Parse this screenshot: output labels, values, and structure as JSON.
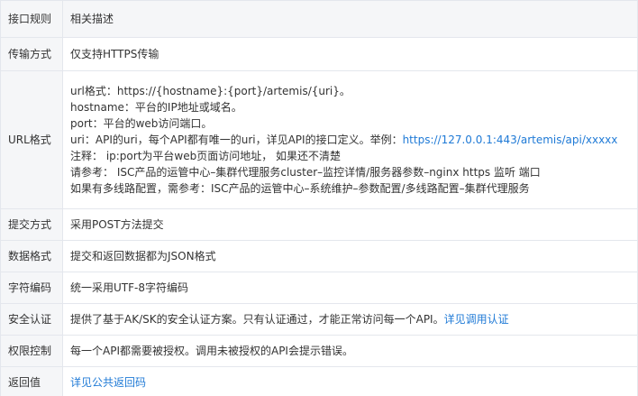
{
  "header": {
    "col1": "接口规则",
    "col2": "相关描述"
  },
  "rows": {
    "transport": {
      "label": "传输方式",
      "desc": "仅支持HTTPS传输"
    },
    "url": {
      "label": "URL格式",
      "line1": "url格式：https://{hostname}:{port}/artemis/{uri}。",
      "line2": "hostname：平台的IP地址或域名。",
      "line3": "port：平台的web访问端口。",
      "line4_text": "uri：API的uri，每个API都有唯一的uri，详见API的接口定义。举例：",
      "line4_link": "https://127.0.0.1:443/artemis/api/xxxxx",
      "line5": "注释：  ip:port为平台web页面访问地址，  如果还不清楚",
      "line6": "请参考：  ISC产品的运管中心–集群代理服务cluster–监控详情/服务器参数–nginx https 监听 端口",
      "line7": "如果有多线路配置，需参考：ISC产品的运管中心–系统维护–参数配置/多线路配置–集群代理服务"
    },
    "submit": {
      "label": "提交方式",
      "desc": "采用POST方法提交"
    },
    "format": {
      "label": "数据格式",
      "desc": "提交和返回数据都为JSON格式"
    },
    "encoding": {
      "label": "字符编码",
      "desc": "统一采用UTF-8字符编码"
    },
    "auth": {
      "label": "安全认证",
      "desc": "提供了基于AK/SK的安全认证方案。只有认证通过，才能正常访问每一个API。",
      "link": "详见调用认证"
    },
    "permission": {
      "label": "权限控制",
      "desc": "每一个API都需要被授权。调用未被授权的API会提示错误。"
    },
    "return": {
      "label": "返回值",
      "link": "详见公共返回码"
    }
  },
  "colors": {
    "link": "#1f7ad6",
    "label_bg": "#f5f6f8",
    "border": "#e4e7ed"
  }
}
